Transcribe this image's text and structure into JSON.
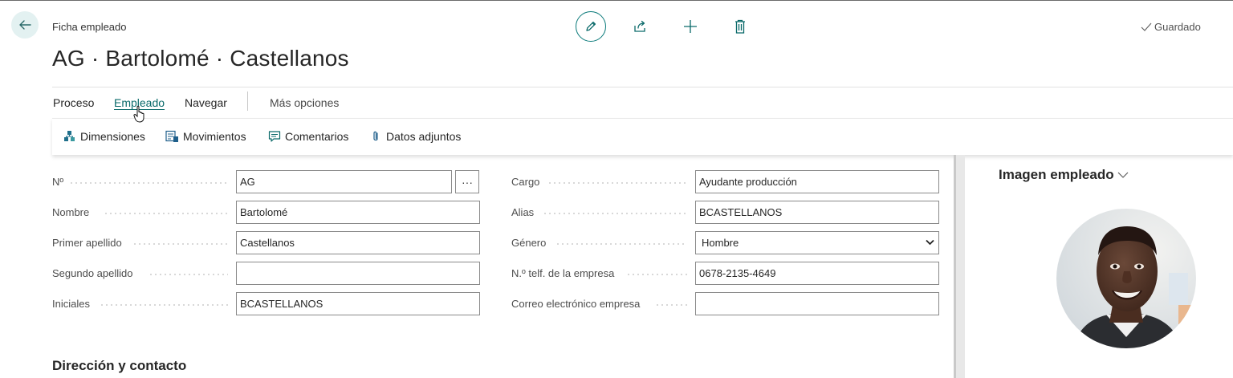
{
  "header": {
    "caption": "Ficha empleado",
    "title": "AG · Bartolomé · Castellanos",
    "status": "Guardado"
  },
  "actions": {
    "edit_icon": "pencil-icon",
    "share_icon": "share-icon",
    "new_icon": "plus-icon",
    "delete_icon": "trash-icon"
  },
  "menu": {
    "items": [
      "Proceso",
      "Empleado",
      "Navegar",
      "Más opciones"
    ],
    "active": "Empleado"
  },
  "subbar": {
    "items": [
      {
        "label": "Dimensiones",
        "icon": "dimensions-icon"
      },
      {
        "label": "Movimientos",
        "icon": "ledger-entries-icon"
      },
      {
        "label": "Comentarios",
        "icon": "comment-icon"
      },
      {
        "label": "Datos adjuntos",
        "icon": "paperclip-icon"
      }
    ]
  },
  "form": {
    "left": [
      {
        "label": "Nº",
        "value": "AG"
      },
      {
        "label": "Nombre",
        "value": "Bartolomé"
      },
      {
        "label": "Primer apellido",
        "value": "Castellanos"
      },
      {
        "label": "Segundo apellido",
        "value": ""
      },
      {
        "label": "Iniciales",
        "value": "BCASTELLANOS"
      }
    ],
    "right": [
      {
        "label": "Cargo",
        "value": "Ayudante producción"
      },
      {
        "label": "Alias",
        "value": "BCASTELLANOS"
      },
      {
        "label": "Género",
        "value": "Hombre"
      },
      {
        "label": "N.º telf. de la empresa",
        "value": "0678-2135-4649"
      },
      {
        "label": "Correo electrónico empresa",
        "value": ""
      }
    ],
    "lookup_button": "···"
  },
  "section": {
    "title": "Dirección y contacto"
  },
  "factbox": {
    "title": "Imagen empleado"
  },
  "colors": {
    "accent": "#0a7a7a",
    "back_bg": "#e3f1f1"
  }
}
